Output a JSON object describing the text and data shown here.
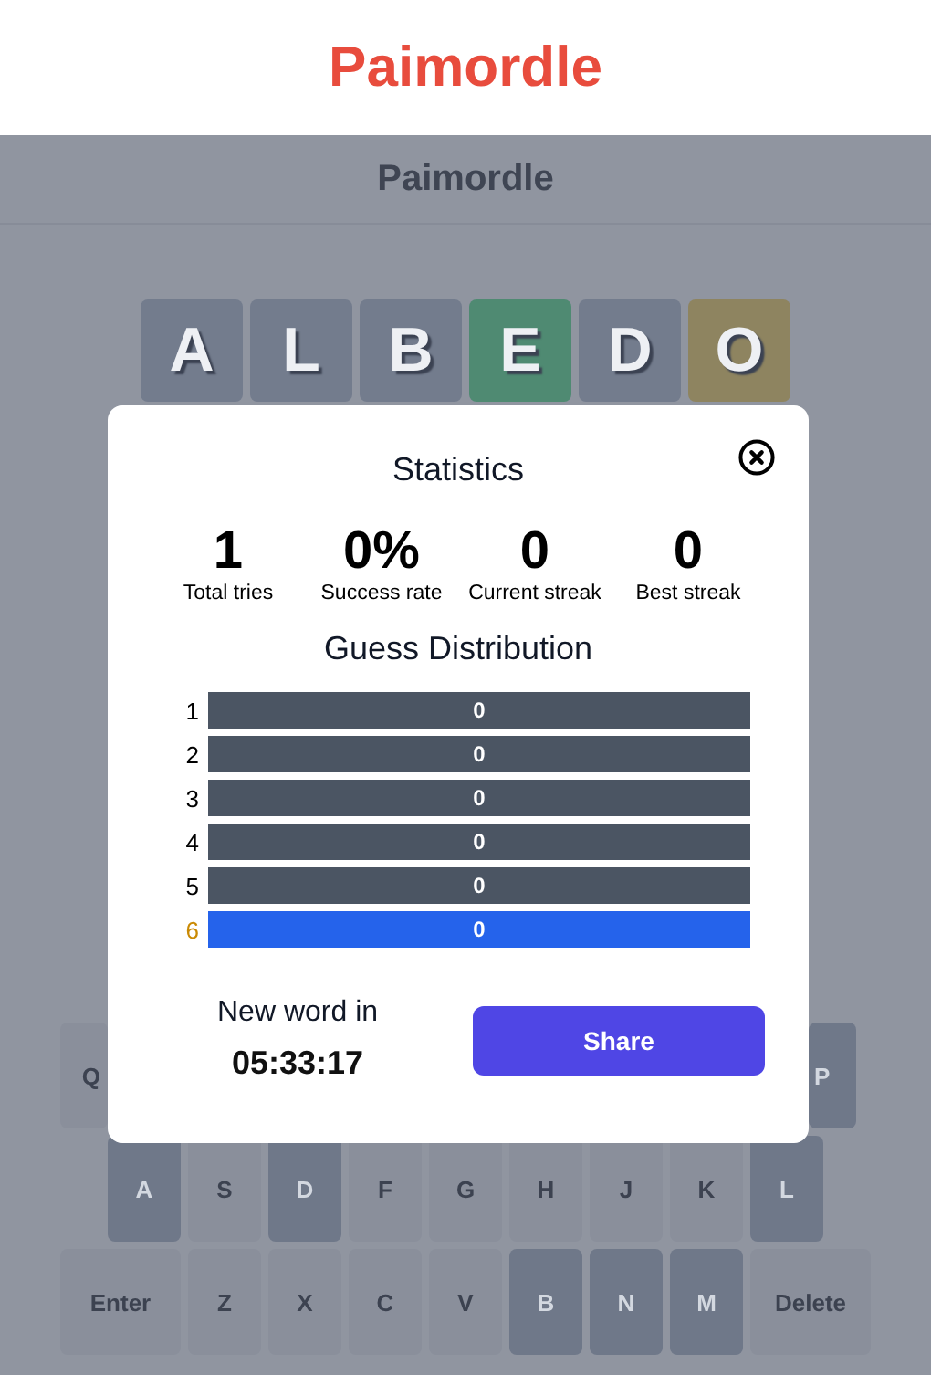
{
  "site_title": "Paimordle",
  "app": {
    "title": "Paimordle"
  },
  "board": {
    "tiles": [
      {
        "letter": "A",
        "correct": false,
        "present": false
      },
      {
        "letter": "L",
        "correct": false,
        "present": false
      },
      {
        "letter": "B",
        "correct": false,
        "present": false
      },
      {
        "letter": "E",
        "correct": true,
        "present": false
      },
      {
        "letter": "D",
        "correct": false,
        "present": false
      },
      {
        "letter": "O",
        "correct": false,
        "present": true
      }
    ]
  },
  "keyboard": {
    "rows": [
      [
        {
          "label": "Q",
          "used": false,
          "kind": "letter"
        },
        {
          "label": "P",
          "used": true,
          "kind": "letter"
        }
      ],
      [
        {
          "label": "A",
          "used": true,
          "kind": "letter"
        },
        {
          "label": "S",
          "used": false,
          "kind": "letter"
        },
        {
          "label": "D",
          "used": true,
          "kind": "letter"
        },
        {
          "label": "F",
          "used": false,
          "kind": "letter"
        },
        {
          "label": "G",
          "used": false,
          "kind": "letter"
        },
        {
          "label": "H",
          "used": false,
          "kind": "letter"
        },
        {
          "label": "J",
          "used": false,
          "kind": "letter"
        },
        {
          "label": "K",
          "used": false,
          "kind": "letter"
        },
        {
          "label": "L",
          "used": true,
          "kind": "letter"
        }
      ],
      [
        {
          "label": "Enter",
          "used": false,
          "kind": "wide"
        },
        {
          "label": "Z",
          "used": false,
          "kind": "letter"
        },
        {
          "label": "X",
          "used": false,
          "kind": "letter"
        },
        {
          "label": "C",
          "used": false,
          "kind": "letter"
        },
        {
          "label": "V",
          "used": false,
          "kind": "letter"
        },
        {
          "label": "B",
          "used": true,
          "kind": "letter"
        },
        {
          "label": "N",
          "used": true,
          "kind": "letter"
        },
        {
          "label": "M",
          "used": true,
          "kind": "letter"
        },
        {
          "label": "Delete",
          "used": false,
          "kind": "wide"
        }
      ]
    ]
  },
  "modal": {
    "title": "Statistics",
    "stats": [
      {
        "value": "1",
        "label": "Total tries"
      },
      {
        "value": "0%",
        "label": "Success rate"
      },
      {
        "value": "0",
        "label": "Current streak"
      },
      {
        "value": "0",
        "label": "Best streak"
      }
    ],
    "distribution_title": "Guess Distribution",
    "distribution": [
      {
        "guess": "1",
        "count": "0",
        "selected": false
      },
      {
        "guess": "2",
        "count": "0",
        "selected": false
      },
      {
        "guess": "3",
        "count": "0",
        "selected": false
      },
      {
        "guess": "4",
        "count": "0",
        "selected": false
      },
      {
        "guess": "5",
        "count": "0",
        "selected": false
      },
      {
        "guess": "6",
        "count": "0",
        "selected": true
      }
    ],
    "countdown_label": "New word in",
    "countdown": "05:33:17",
    "share_button": "Share"
  }
}
